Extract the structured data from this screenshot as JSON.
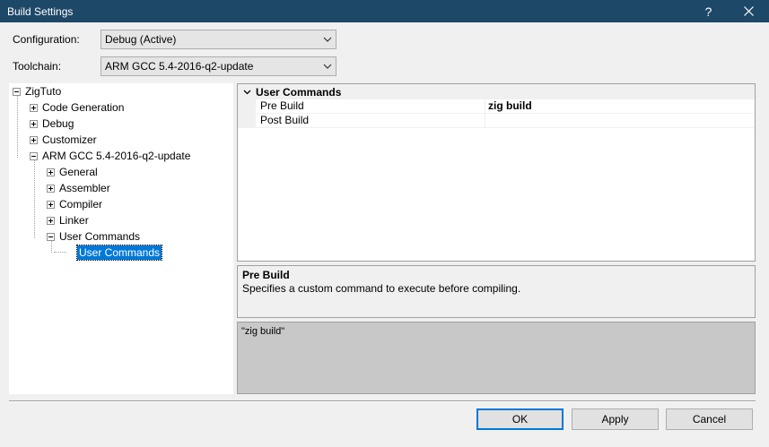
{
  "window": {
    "title": "Build Settings",
    "help": "?",
    "close": "✕"
  },
  "configuration": {
    "label": "Configuration:",
    "value": "Debug (Active)"
  },
  "toolchain": {
    "label": "Toolchain:",
    "value": "ARM GCC 5.4-2016-q2-update"
  },
  "tree": {
    "root": "ZigTuto",
    "items": [
      "Code Generation",
      "Debug",
      "Customizer",
      "ARM GCC 5.4-2016-q2-update",
      "General",
      "Assembler",
      "Compiler",
      "Linker",
      "User Commands",
      "User Commands"
    ]
  },
  "properties": {
    "category": "User Commands",
    "rows": [
      {
        "name": "Pre Build",
        "value": "zig build"
      },
      {
        "name": "Post Build",
        "value": ""
      }
    ]
  },
  "description": {
    "title": "Pre Build",
    "text": "Specifies a custom command to execute before compiling."
  },
  "value_editor": {
    "text": "\"zig build\""
  },
  "buttons": {
    "ok": "OK",
    "apply": "Apply",
    "cancel": "Cancel"
  }
}
